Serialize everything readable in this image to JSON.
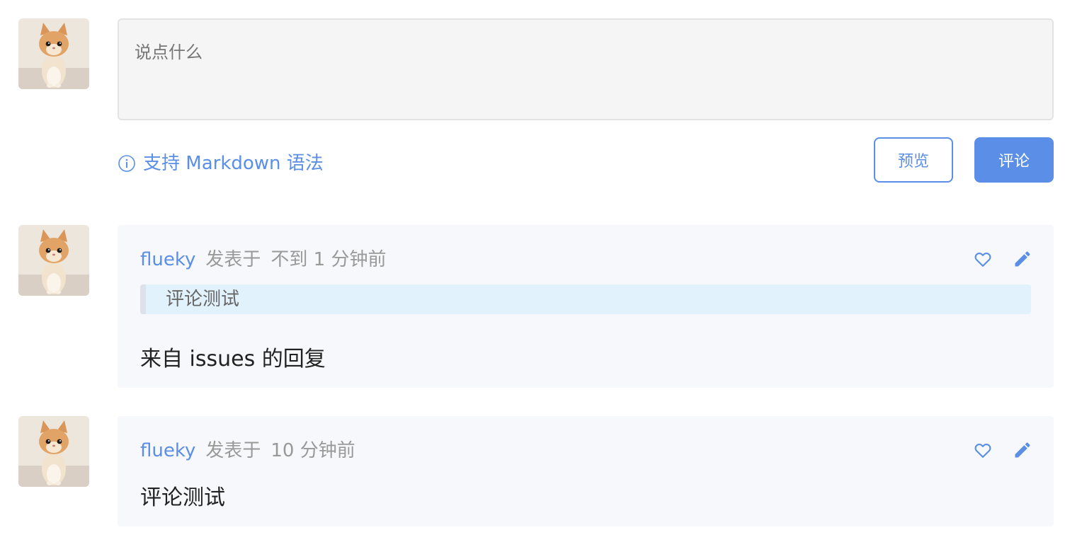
{
  "editor": {
    "placeholder": "说点什么",
    "markdown_hint": "支持 Markdown 语法",
    "preview_label": "预览",
    "submit_label": "评论"
  },
  "colors": {
    "accent": "#5b8ee6",
    "card_bg": "#f6f8fc",
    "quote_bg": "#e2f2fd"
  },
  "comments": [
    {
      "author": "flueky",
      "posted_label": "发表于",
      "time": "不到 1 分钟前",
      "quote": "评论测试",
      "body": "来自 issues 的回复",
      "like_icon": "heart-outline-icon",
      "edit_icon": "pencil-icon"
    },
    {
      "author": "flueky",
      "posted_label": "发表于",
      "time": "10 分钟前",
      "body": "评论测试",
      "like_icon": "heart-outline-icon",
      "edit_icon": "pencil-icon"
    }
  ]
}
